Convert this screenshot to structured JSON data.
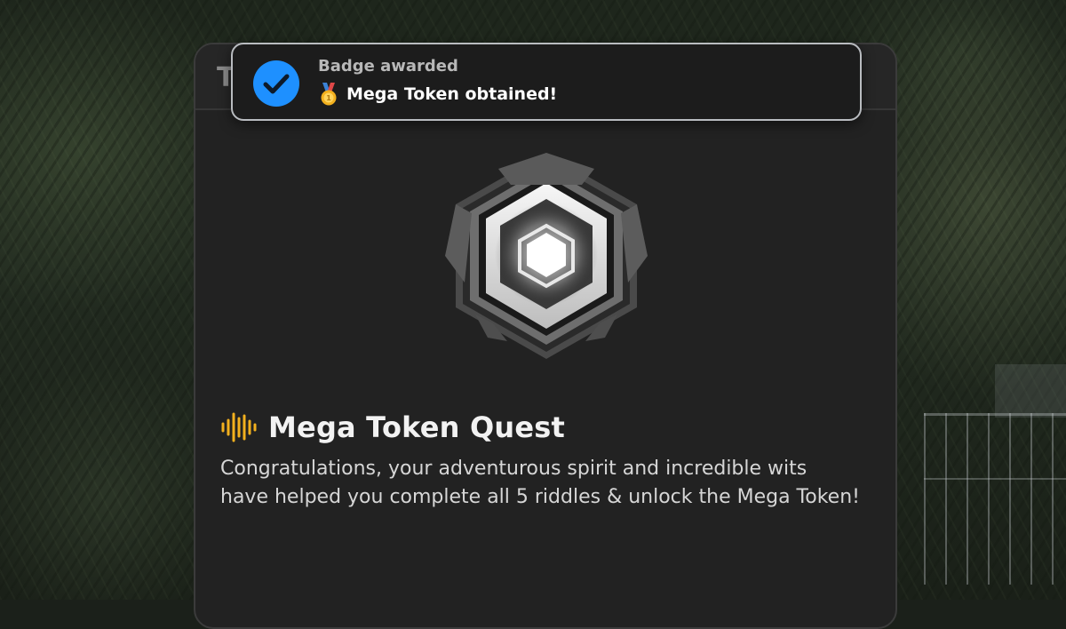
{
  "panel": {
    "peek_text": "T"
  },
  "toast": {
    "title": "Badge awarded",
    "message": "Mega Token obtained!",
    "status_icon": "check-circle-icon",
    "prefix_icon": "medal-icon",
    "accent_color": "#1e90ff"
  },
  "badge": {
    "icon": "hexagon-badge-icon"
  },
  "quest": {
    "title_icon": "audio-wave-icon",
    "title": "Mega Token Quest",
    "description": "Congratulations, your adventurous spirit and incredible wits have helped you complete all 5 riddles & unlock the Mega Token!",
    "accent_color": "#f2b01e"
  }
}
